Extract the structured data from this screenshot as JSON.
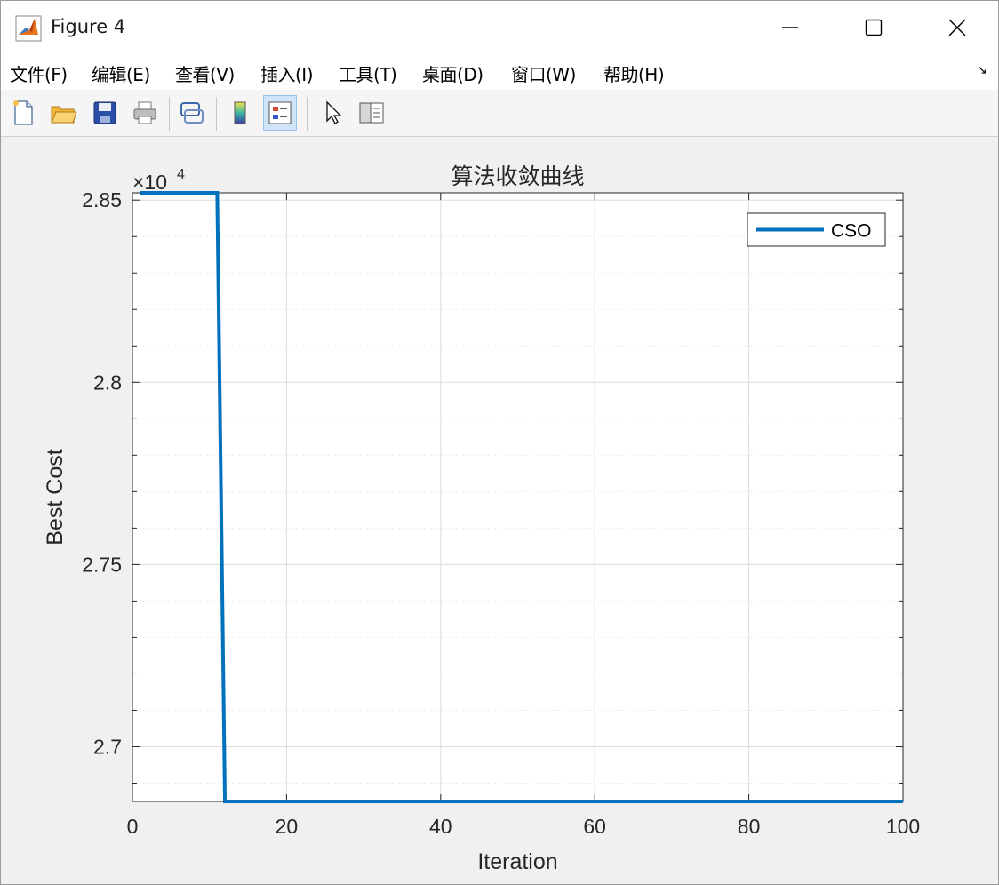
{
  "window": {
    "title": "Figure 4"
  },
  "menu": {
    "items": [
      {
        "label": "文件(F)"
      },
      {
        "label": "编辑(E)"
      },
      {
        "label": "查看(V)"
      },
      {
        "label": "插入(I)"
      },
      {
        "label": "工具(T)"
      },
      {
        "label": "桌面(D)"
      },
      {
        "label": "窗口(W)"
      },
      {
        "label": "帮助(H)"
      }
    ],
    "dock_arrow": "↘"
  },
  "toolbar": {
    "buttons": [
      {
        "icon": "new-figure-icon"
      },
      {
        "icon": "open-file-icon"
      },
      {
        "icon": "save-icon"
      },
      {
        "icon": "print-icon"
      },
      {
        "icon": "link-plot-icon"
      },
      {
        "icon": "colorbar-icon"
      },
      {
        "icon": "legend-icon",
        "active": true
      },
      {
        "icon": "pointer-icon"
      },
      {
        "icon": "property-inspector-icon"
      }
    ]
  },
  "chart_data": {
    "type": "line",
    "title": "算法收敛曲线",
    "xlabel": "Iteration",
    "ylabel": "Best Cost",
    "exponent_label": "×10",
    "exponent_power": "4",
    "xlim": [
      0,
      100
    ],
    "ylim": [
      2.685,
      2.852
    ],
    "xticks": [
      "0",
      "20",
      "40",
      "60",
      "80",
      "100"
    ],
    "xtick_values": [
      0,
      20,
      40,
      60,
      80,
      100
    ],
    "yticks": [
      "2.7",
      "2.75",
      "2.8",
      "2.85"
    ],
    "ytick_values": [
      2.7,
      2.75,
      2.8,
      2.85
    ],
    "grid": true,
    "minor_grid": true,
    "legend_position": "top-right",
    "series": [
      {
        "name": "CSO",
        "color": "#0072BD",
        "points": [
          [
            1,
            2.852
          ],
          [
            11,
            2.852
          ],
          [
            12,
            2.685
          ],
          [
            100,
            2.685
          ]
        ]
      }
    ]
  }
}
